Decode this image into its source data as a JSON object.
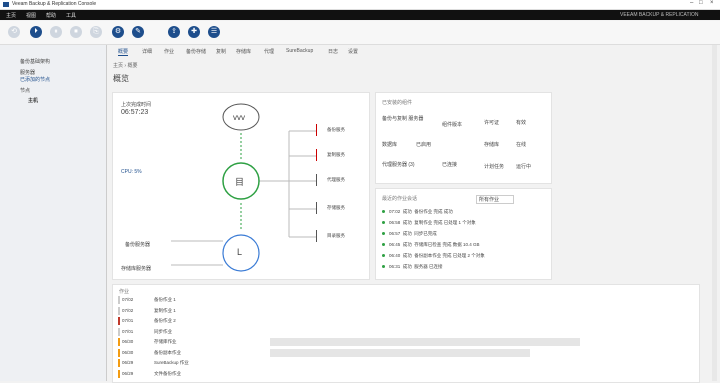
{
  "window": {
    "title": "Veeam Backup & Replication Console",
    "controls": [
      "–",
      "□",
      "×"
    ]
  },
  "menubar": {
    "items": [
      "主页",
      "视图",
      "帮助",
      "工具"
    ],
    "right_text": "VEEAM BACKUP & REPLICATION"
  },
  "toolbar": {
    "buttons": [
      "⟲",
      "⏵",
      "⏸",
      "⏹",
      "⎘",
      "⚙",
      "✎",
      "⇪",
      "✚",
      "☰"
    ]
  },
  "sidebar": {
    "items": [
      "备份基础架构",
      "服务器",
      "已添加的节点",
      "节点",
      "主机"
    ]
  },
  "tabs": [
    "概要",
    "详细",
    "作业",
    "备份存储",
    "复制",
    "存储库",
    "代理",
    "SureBackup",
    "日志",
    "设置"
  ],
  "breadcrumb": "主页 › 概要",
  "page_title": "概览",
  "diagram": {
    "last_backup_label": "上次完成时间",
    "last_backup_time": "06:57:23",
    "cpu_label": "CPU: 5%",
    "top_node": "vvv",
    "middle_node": "目",
    "bottom_node": "L",
    "services": [
      "备份服务",
      "复制服务",
      "代理服务",
      "存储服务",
      "目录服务"
    ],
    "left_items": [
      "备份服务器",
      "存储库服务器"
    ]
  },
  "info_panel": {
    "title": "已安装的组件",
    "items": [
      {
        "label": "备份与复制 服务器",
        "value": "组件版本"
      },
      {
        "label": "数据库",
        "value": "已启用"
      },
      {
        "label": "代理服务器 (3)",
        "value": "已连接"
      },
      {
        "label": "许可证",
        "value": "有效"
      },
      {
        "label": "存储库",
        "value": "在线"
      },
      {
        "label": "计划任务",
        "value": "运行中"
      }
    ]
  },
  "log_panel": {
    "title": "最近的作业会话",
    "filter": "所有作业",
    "rows": [
      {
        "time": "07:02",
        "status": "成功",
        "text": "备份作业 完成 成功"
      },
      {
        "time": "06:58",
        "status": "成功",
        "text": "复制作业 完成 已处理 1 个对象"
      },
      {
        "time": "06:57",
        "status": "成功",
        "text": "同步已完成"
      },
      {
        "time": "06:45",
        "status": "成功",
        "text": "存储库已检查 完成 数据 10.4 GB"
      },
      {
        "time": "06:40",
        "status": "成功",
        "text": "备份副本作业 完成 已处理 2 个对象"
      },
      {
        "time": "06:31",
        "status": "成功",
        "text": "服务器 已连接"
      }
    ]
  },
  "timeline": {
    "title": "作业",
    "rows": [
      {
        "date": "07/02",
        "name": "备份作业 1",
        "color": "#cccccc",
        "bar": 0
      },
      {
        "date": "07/02",
        "name": "复制作业 1",
        "color": "#cccccc",
        "bar": 0
      },
      {
        "date": "07/01",
        "name": "备份作业 2",
        "color": "#c0392b",
        "bar": 0
      },
      {
        "date": "07/01",
        "name": "同步作业",
        "color": "#cccccc",
        "bar": 0
      },
      {
        "date": "06/30",
        "name": "存储库作业",
        "color": "#f39c12",
        "bar": 310
      },
      {
        "date": "06/30",
        "name": "备份副本作业",
        "color": "#f39c12",
        "bar": 260
      },
      {
        "date": "06/29",
        "name": "SureBackup 作业",
        "color": "#f39c12",
        "bar": 0
      },
      {
        "date": "06/29",
        "name": "文件备份作业",
        "color": "#f39c12",
        "bar": 0
      }
    ]
  },
  "colors": {
    "accent": "#1e4e8c",
    "green": "#2ea043",
    "red": "#c0392b",
    "orange": "#f39c12"
  }
}
